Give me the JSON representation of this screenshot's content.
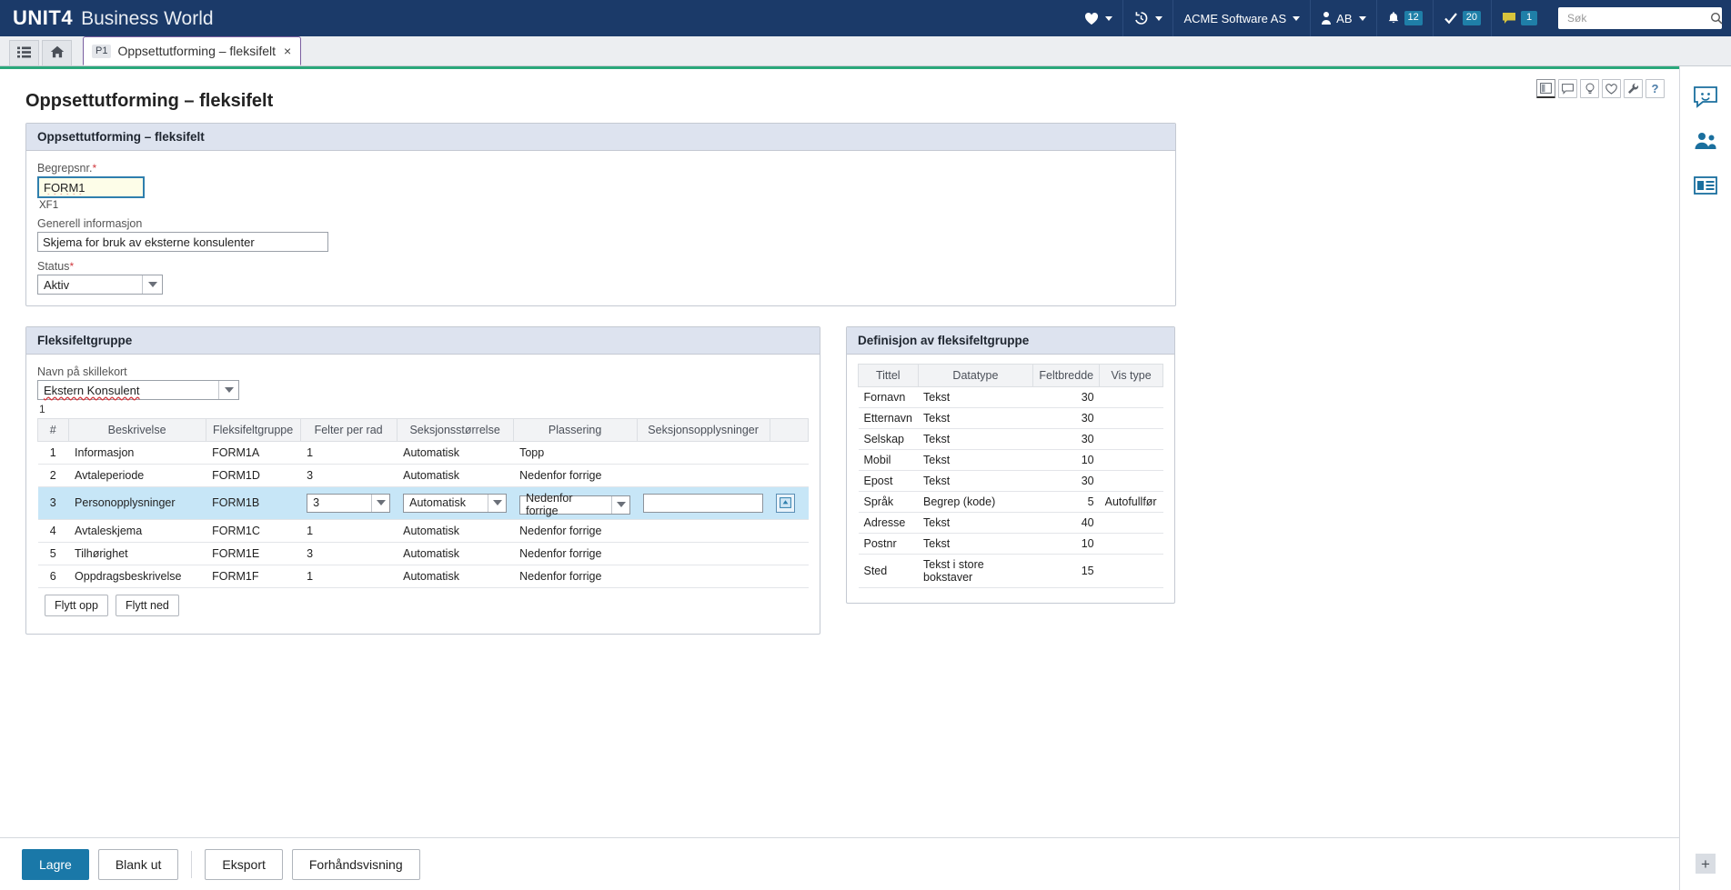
{
  "topbar": {
    "brand_main": "UNIT4",
    "brand_sub": "Business World",
    "favorites_icon": "heart-icon",
    "history_icon": "history-icon",
    "company": "ACME Software AS",
    "user_icon": "user-icon",
    "user_initials": "AB",
    "bell_icon": "bell-icon",
    "bell_count": "12",
    "tasks_icon": "check-icon",
    "tasks_count": "20",
    "messages_icon": "message-icon",
    "messages_count": "1",
    "search_placeholder": "Søk",
    "search_value": "",
    "search_icon": "search-icon"
  },
  "tabstrip": {
    "menu_icon": "list-menu-icon",
    "home_icon": "home-icon",
    "tab_pill": "P1",
    "tab_label": "Oppsettutforming – fleksifelt",
    "tab_close": "×"
  },
  "page_icons": [
    {
      "name": "split-view-icon",
      "glyph": "▥"
    },
    {
      "name": "comment-icon",
      "glyph": "💬"
    },
    {
      "name": "lightbulb-icon",
      "glyph": "💡"
    },
    {
      "name": "heart-icon",
      "glyph": "♡"
    },
    {
      "name": "wrench-icon",
      "glyph": "🔧"
    },
    {
      "name": "help-icon",
      "glyph": "?"
    }
  ],
  "page": {
    "title": "Oppsettutforming – fleksifelt"
  },
  "form_panel": {
    "header": "Oppsettutforming – fleksifelt",
    "begrepsnr_label": "Begrepsnr.",
    "begrepsnr_required": "*",
    "begrepsnr_value": "FORM1",
    "begrepsnr_hint": "XF1",
    "generell_label": "Generell informasjon",
    "generell_value": "Skjema for bruk av eksterne konsulenter",
    "status_label": "Status",
    "status_required": "*",
    "status_value": "Aktiv"
  },
  "group_panel": {
    "header": "Fleksifeltgruppe",
    "skillekort_label": "Navn på skillekort",
    "skillekort_value": "Ekstern Konsulent",
    "grid_count": "1",
    "columns": [
      "#",
      "Beskrivelse",
      "Fleksifeltgruppe",
      "Felter per rad",
      "Seksjonsstørrelse",
      "Plassering",
      "Seksjonsopplysninger",
      ""
    ],
    "rows": [
      {
        "num": "1",
        "beskrivelse": "Informasjon",
        "gruppe": "FORM1A",
        "felter": "1",
        "storrelse": "Automatisk",
        "plassering": "Topp",
        "opplysninger": "",
        "selected": false
      },
      {
        "num": "2",
        "beskrivelse": "Avtaleperiode",
        "gruppe": "FORM1D",
        "felter": "3",
        "storrelse": "Automatisk",
        "plassering": "Nedenfor forrige",
        "opplysninger": "",
        "selected": false
      },
      {
        "num": "3",
        "beskrivelse": "Personopplysninger",
        "gruppe": "FORM1B",
        "felter": "3",
        "storrelse": "Automatisk",
        "plassering": "Nedenfor forrige",
        "opplysninger": "",
        "selected": true
      },
      {
        "num": "4",
        "beskrivelse": "Avtaleskjema",
        "gruppe": "FORM1C",
        "felter": "1",
        "storrelse": "Automatisk",
        "plassering": "Nedenfor forrige",
        "opplysninger": "",
        "selected": false
      },
      {
        "num": "5",
        "beskrivelse": "Tilhørighet",
        "gruppe": "FORM1E",
        "felter": "3",
        "storrelse": "Automatisk",
        "plassering": "Nedenfor forrige",
        "opplysninger": "",
        "selected": false
      },
      {
        "num": "6",
        "beskrivelse": "Oppdragsbeskrivelse",
        "gruppe": "FORM1F",
        "felter": "1",
        "storrelse": "Automatisk",
        "plassering": "Nedenfor forrige",
        "opplysninger": "",
        "selected": false
      }
    ],
    "move_up": "Flytt opp",
    "move_down": "Flytt ned",
    "lookup_icon": "lookup-icon"
  },
  "definition_panel": {
    "header": "Definisjon av fleksifeltgruppe",
    "columns": [
      "Tittel",
      "Datatype",
      "Feltbredde",
      "Vis type"
    ],
    "rows": [
      {
        "tittel": "Fornavn",
        "datatype": "Tekst",
        "feltbredde": "30",
        "vistype": ""
      },
      {
        "tittel": "Etternavn",
        "datatype": "Tekst",
        "feltbredde": "30",
        "vistype": ""
      },
      {
        "tittel": "Selskap",
        "datatype": "Tekst",
        "feltbredde": "30",
        "vistype": ""
      },
      {
        "tittel": "Mobil",
        "datatype": "Tekst",
        "feltbredde": "10",
        "vistype": ""
      },
      {
        "tittel": "Epost",
        "datatype": "Tekst",
        "feltbredde": "30",
        "vistype": ""
      },
      {
        "tittel": "Språk",
        "datatype": "Begrep (kode)",
        "feltbredde": "5",
        "vistype": "Autofullfør"
      },
      {
        "tittel": "Adresse",
        "datatype": "Tekst",
        "feltbredde": "40",
        "vistype": ""
      },
      {
        "tittel": "Postnr",
        "datatype": "Tekst",
        "feltbredde": "10",
        "vistype": ""
      },
      {
        "tittel": "Sted",
        "datatype": "Tekst i store bokstaver",
        "feltbredde": "15",
        "vistype": ""
      }
    ]
  },
  "footer": {
    "save": "Lagre",
    "clear": "Blank ut",
    "export": "Eksport",
    "preview": "Forhåndsvisning"
  },
  "rail": {
    "chat_icon": "chat-smiley-icon",
    "people_icon": "people-icon",
    "notes_icon": "notes-icon",
    "plus_icon": "plus-icon"
  },
  "colors": {
    "nav_blue": "#1b3a69",
    "accent_blue": "#1a78a8",
    "panel_head": "#dde3ef",
    "row_selected": "#c7e6f7",
    "badge_blue": "#1f7fa8",
    "green_line": "#2aa87b",
    "required_red": "#d0393e",
    "tab_purple": "#7b5fa0"
  }
}
